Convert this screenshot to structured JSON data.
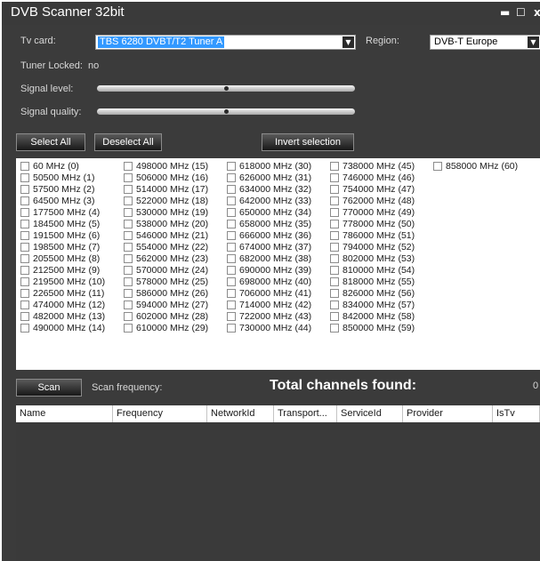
{
  "window": {
    "title": "DVB Scanner 32bit",
    "minimize_glyph": "▬",
    "maximize_glyph": "☐",
    "close_glyph": "x"
  },
  "form": {
    "tv_card_label": "Tv card:",
    "tv_card_value": "TBS 6280 DVBT/T2 Tuner A",
    "region_label": "Region:",
    "region_value": "DVB-T Europe",
    "tuner_locked_label": "Tuner Locked:",
    "tuner_locked_value": "no",
    "signal_level_label": "Signal level:",
    "signal_quality_label": "Signal quality:",
    "signal_level": 0.5,
    "signal_quality": 0.5
  },
  "buttons": {
    "select_all": "Select All",
    "deselect_all": "Deselect All",
    "invert_selection": "Invert selection",
    "scan": "Scan"
  },
  "frequencies": [
    [
      "60 MHz (0)",
      "50500 MHz (1)",
      "57500 MHz (2)",
      "64500 MHz (3)",
      "177500 MHz (4)",
      "184500 MHz (5)",
      "191500 MHz (6)",
      "198500 MHz (7)",
      "205500 MHz (8)",
      "212500 MHz (9)",
      "219500 MHz (10)",
      "226500 MHz (11)",
      "474000 MHz (12)",
      "482000 MHz (13)",
      "490000 MHz (14)"
    ],
    [
      "498000 MHz (15)",
      "506000 MHz (16)",
      "514000 MHz (17)",
      "522000 MHz (18)",
      "530000 MHz (19)",
      "538000 MHz (20)",
      "546000 MHz (21)",
      "554000 MHz (22)",
      "562000 MHz (23)",
      "570000 MHz (24)",
      "578000 MHz (25)",
      "586000 MHz (26)",
      "594000 MHz (27)",
      "602000 MHz (28)",
      "610000 MHz (29)"
    ],
    [
      "618000 MHz (30)",
      "626000 MHz (31)",
      "634000 MHz (32)",
      "642000 MHz (33)",
      "650000 MHz (34)",
      "658000 MHz (35)",
      "666000 MHz (36)",
      "674000 MHz (37)",
      "682000 MHz (38)",
      "690000 MHz (39)",
      "698000 MHz (40)",
      "706000 MHz (41)",
      "714000 MHz (42)",
      "722000 MHz (43)",
      "730000 MHz (44)"
    ],
    [
      "738000 MHz (45)",
      "746000 MHz (46)",
      "754000 MHz (47)",
      "762000 MHz (48)",
      "770000 MHz (49)",
      "778000 MHz (50)",
      "786000 MHz (51)",
      "794000 MHz (52)",
      "802000 MHz (53)",
      "810000 MHz (54)",
      "818000 MHz (55)",
      "826000 MHz (56)",
      "834000 MHz (57)",
      "842000 MHz (58)",
      "850000 MHz (59)"
    ],
    [
      "858000 MHz (60)"
    ]
  ],
  "scan": {
    "frequency_label": "Scan frequency:",
    "total_label": "Total channels found:",
    "total_count": "0"
  },
  "table": {
    "columns": [
      "Name",
      "Frequency",
      "NetworkId",
      "Transport...",
      "ServiceId",
      "Provider",
      "IsTv"
    ]
  },
  "colors": {
    "window_bg": "#3b3b3b",
    "selection": "#3399ff",
    "button_dark": "#181818"
  }
}
